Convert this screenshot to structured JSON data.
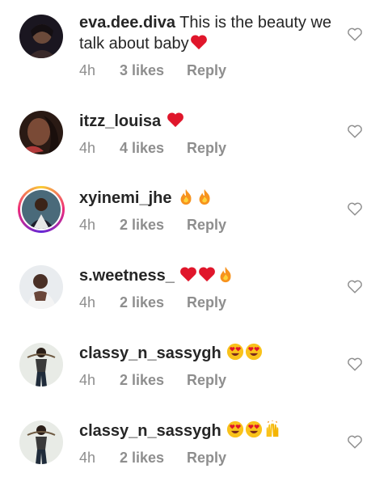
{
  "comments": [
    {
      "username": "eva.dee.diva",
      "text": "This is the beauty we talk about baby",
      "emojis": [
        "red-heart"
      ],
      "time": "4h",
      "likes": "3 likes",
      "reply": "Reply"
    },
    {
      "username": "itzz_louisa",
      "text": "",
      "emojis": [
        "red-heart"
      ],
      "time": "4h",
      "likes": "4 likes",
      "reply": "Reply"
    },
    {
      "username": "xyinemi_jhe",
      "text": "",
      "emojis": [
        "fire",
        "fire"
      ],
      "time": "4h",
      "likes": "2 likes",
      "reply": "Reply"
    },
    {
      "username": "s.weetness_",
      "text": "",
      "emojis": [
        "red-heart",
        "red-heart",
        "fire"
      ],
      "time": "4h",
      "likes": "2 likes",
      "reply": "Reply"
    },
    {
      "username": "classy_n_sassygh",
      "text": "",
      "emojis": [
        "heart-eyes",
        "heart-eyes"
      ],
      "time": "4h",
      "likes": "2 likes",
      "reply": "Reply"
    },
    {
      "username": "classy_n_sassygh",
      "text": "",
      "emojis": [
        "heart-eyes",
        "heart-eyes",
        "raised-hands"
      ],
      "time": "4h",
      "likes": "2 likes",
      "reply": "Reply"
    }
  ],
  "colors": {
    "text": "#262626",
    "meta": "#8e8e8e",
    "heart_emoji": "#e0162b",
    "fire": "#f7931e",
    "background": "#ffffff"
  }
}
